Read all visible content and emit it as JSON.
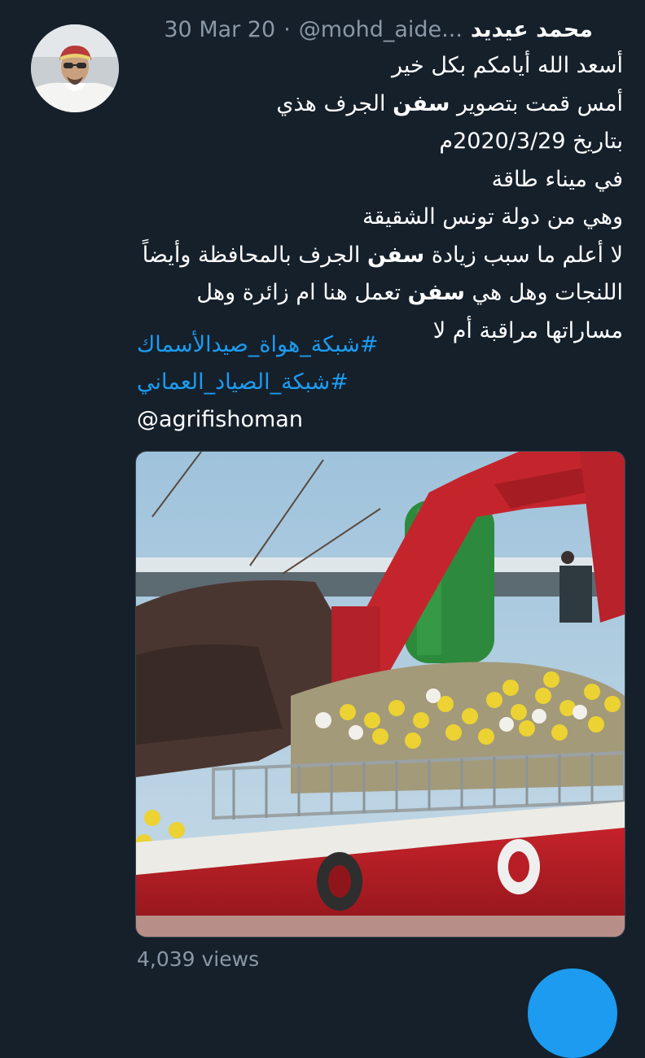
{
  "author": {
    "display_name": "محمد عيديد",
    "handle": "@mohd_aide...",
    "separator": "·",
    "date": "30 Mar 20"
  },
  "body": {
    "line1": "أسعد الله أيامكم بكل خير",
    "line2_pre": "أمس قمت بتصوير ",
    "line2_bold": "سفن",
    "line2_post": " الجرف هذي",
    "line3": "بتاريخ 2020/3/29م",
    "line4": "في ميناء طاقة",
    "line5": "وهي من دولة تونس الشقيقة",
    "line6_pre": "لا أعلم ما سبب زيادة ",
    "line6_bold": "سفن",
    "line6_post": " الجرف بالمحافظة وأيضاً",
    "line7_pre": "اللنجات وهل هي ",
    "line7_bold": "سفن",
    "line7_post": " تعمل هنا ام زائرة وهل",
    "line8": "مساراتها مراقبة أم لا"
  },
  "hashtags": [
    "#شبكة_هواة_صيدالأسماك",
    "#شبكة_الصياد_العماني"
  ],
  "mention": "@agrifishoman",
  "stats": {
    "views": "4,039 views"
  },
  "colors": {
    "background": "#15202b",
    "accent": "#1d9bf0",
    "muted": "#8b98a5"
  }
}
